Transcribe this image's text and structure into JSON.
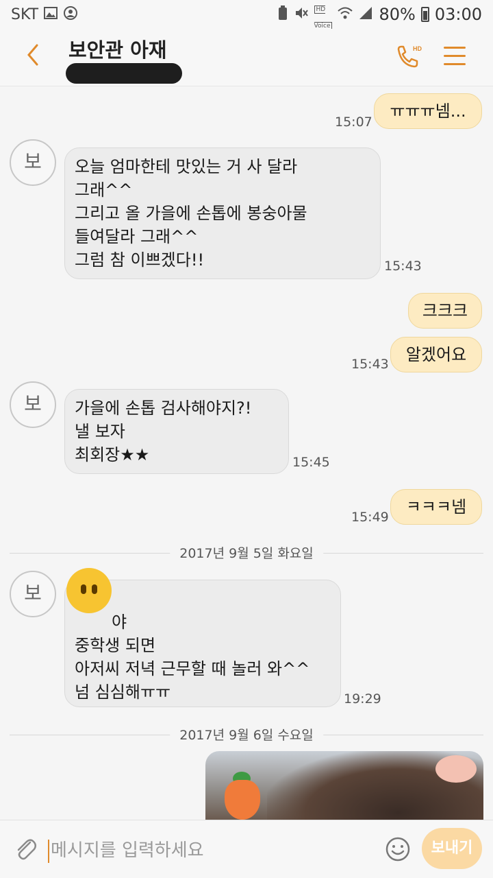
{
  "status_bar": {
    "carrier": "SKT",
    "battery": "80%",
    "time": "03:00",
    "icons": [
      "gallery-icon",
      "account-icon",
      "battery-saver-icon",
      "mute-icon",
      "hd-voice-icon",
      "wifi-icon",
      "signal-icon",
      "battery-icon"
    ],
    "hd_label_top": "HD",
    "hd_label_bottom": "Voice"
  },
  "header": {
    "title": "보안관 아재",
    "call_badge": "HD",
    "accent_color": "#e08a2b"
  },
  "avatar_label": "보",
  "messages": [
    {
      "dir": "out",
      "text": "ㅠㅠㅠ넴...",
      "time": "15:07"
    },
    {
      "dir": "in",
      "text": "오늘 엄마한테 맛있는 거 사 달라\n그래^^\n그리고 올 가을에 손톱에 봉숭아물\n들여달라 그래^^\n그럼 참 이쁘겠다!!",
      "time": "15:43"
    },
    {
      "dir": "out",
      "text": "크크크",
      "time": ""
    },
    {
      "dir": "out",
      "text": "알겠어요",
      "time": "15:43"
    },
    {
      "dir": "in",
      "text": "가을에 손톱 검사해야지?!\n낼 보자\n최회장★★",
      "time": "15:45"
    },
    {
      "dir": "out",
      "text": "ㅋㅋㅋ넴",
      "time": "15:49"
    },
    {
      "dir": "in",
      "text": "야\n중학생 되면\n아저씨 저녁 근무할 때 놀러 와^^\n넘 심심해ㅠㅠ",
      "time": "19:29"
    }
  ],
  "date_separators": [
    "2017년 9월 5일 화요일",
    "2017년 9월 6일 수요일"
  ],
  "input": {
    "placeholder": "메시지를 입력하세요",
    "send_label": "보내기"
  },
  "colors": {
    "incoming_bubble": "#ececec",
    "outgoing_bubble": "#fdebc2",
    "send_button": "#fbd9a3"
  }
}
